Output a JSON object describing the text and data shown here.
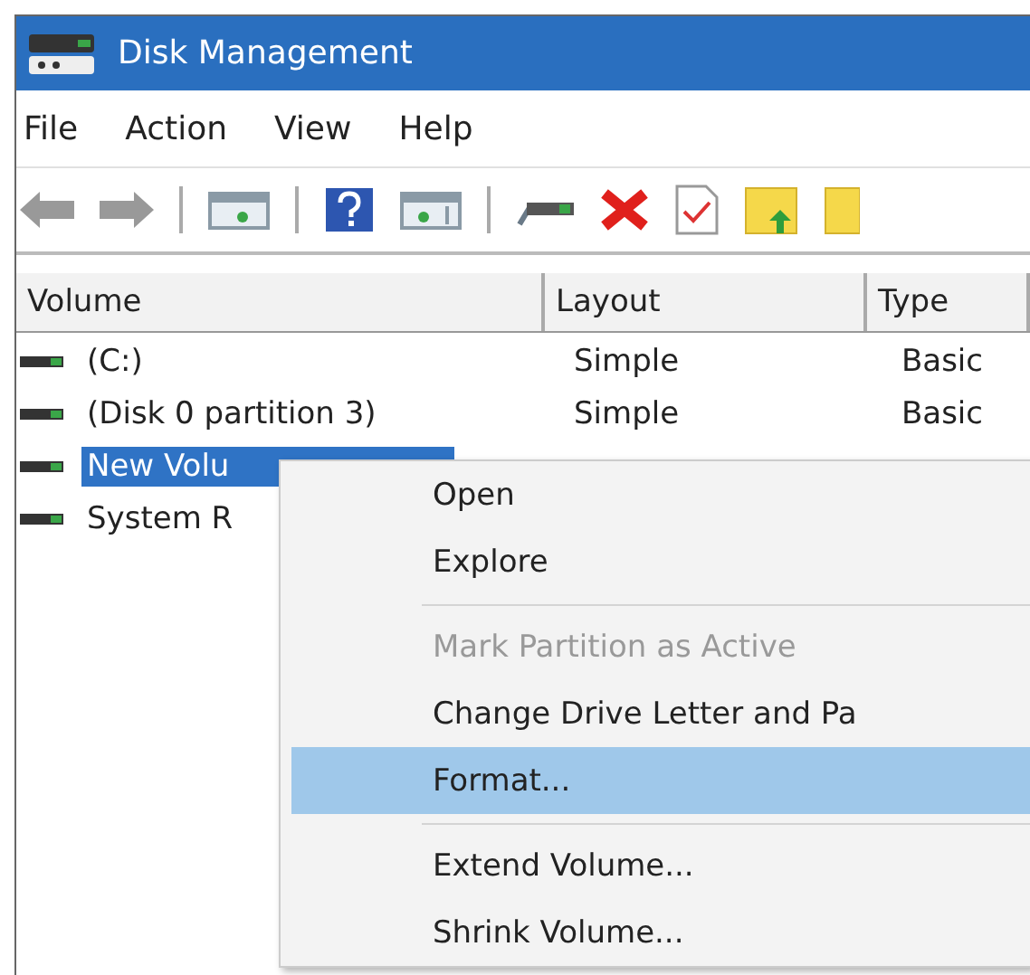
{
  "window": {
    "title": "Disk Management"
  },
  "menu_bar": [
    "File",
    "Action",
    "View",
    "Help"
  ],
  "table": {
    "columns": [
      "Volume",
      "Layout",
      "Type"
    ],
    "rows": [
      {
        "cells": [
          "(C:)",
          "Simple",
          "Basic"
        ],
        "selected": false
      },
      {
        "cells": [
          "(Disk 0 partition 3)",
          "Simple",
          "Basic"
        ],
        "selected": false
      },
      {
        "cells": [
          "New Volu"
        ],
        "selected": true
      },
      {
        "cells": [
          "System R"
        ],
        "selected": false
      }
    ]
  },
  "context_menu": {
    "items": [
      {
        "kind": "item",
        "label": "Open",
        "disabled": false,
        "selected": false
      },
      {
        "kind": "item",
        "label": "Explore",
        "disabled": false,
        "selected": false
      },
      {
        "kind": "separator"
      },
      {
        "kind": "item",
        "label": "Mark Partition as Active",
        "disabled": true,
        "selected": false
      },
      {
        "kind": "item",
        "label": "Change Drive Letter and Pa",
        "disabled": false,
        "selected": false
      },
      {
        "kind": "item",
        "label": "Format...",
        "disabled": false,
        "selected": true
      },
      {
        "kind": "separator"
      },
      {
        "kind": "item",
        "label": "Extend Volume...",
        "disabled": false,
        "selected": false
      },
      {
        "kind": "item",
        "label": "Shrink Volume...",
        "disabled": false,
        "selected": false
      }
    ]
  }
}
